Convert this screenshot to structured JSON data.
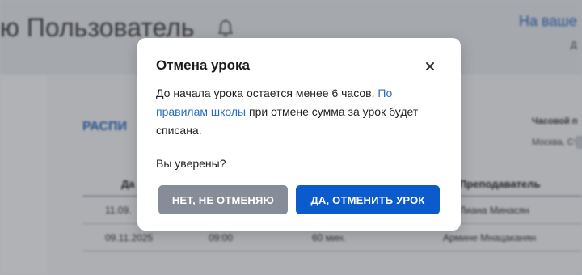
{
  "header": {
    "greeting": "ю Пользователь",
    "balance_link": "На ваше",
    "balance_sub": "Д"
  },
  "schedule": {
    "title": "РАСПИ",
    "timezone_label": "Часовой п",
    "timezone_value": "Москва, Ст",
    "table": {
      "headers": [
        "Да",
        "Преподаватель"
      ],
      "rows": [
        {
          "date": "11.09.",
          "time": "",
          "duration": "",
          "teacher": "Лиана Минасян"
        },
        {
          "date": "09.11.2025",
          "time": "09:00",
          "duration": "60 мин.",
          "teacher": "Армине Мнацаканян"
        }
      ]
    }
  },
  "modal": {
    "title": "Отмена урока",
    "body_before": "До начала урока остается менее 6 часов.",
    "body_link": "По правилам школы",
    "body_after": "при отмене сумма за урок будет списана.",
    "question": "Вы уверены?",
    "cancel_label": "НЕТ, НЕ ОТМЕНЯЮ",
    "confirm_label": "ДА, ОТМЕНИТЬ УРОК"
  },
  "colors": {
    "accent": "#0b5bcc",
    "link": "#2a6cc0",
    "secondary_button": "#868d99"
  }
}
